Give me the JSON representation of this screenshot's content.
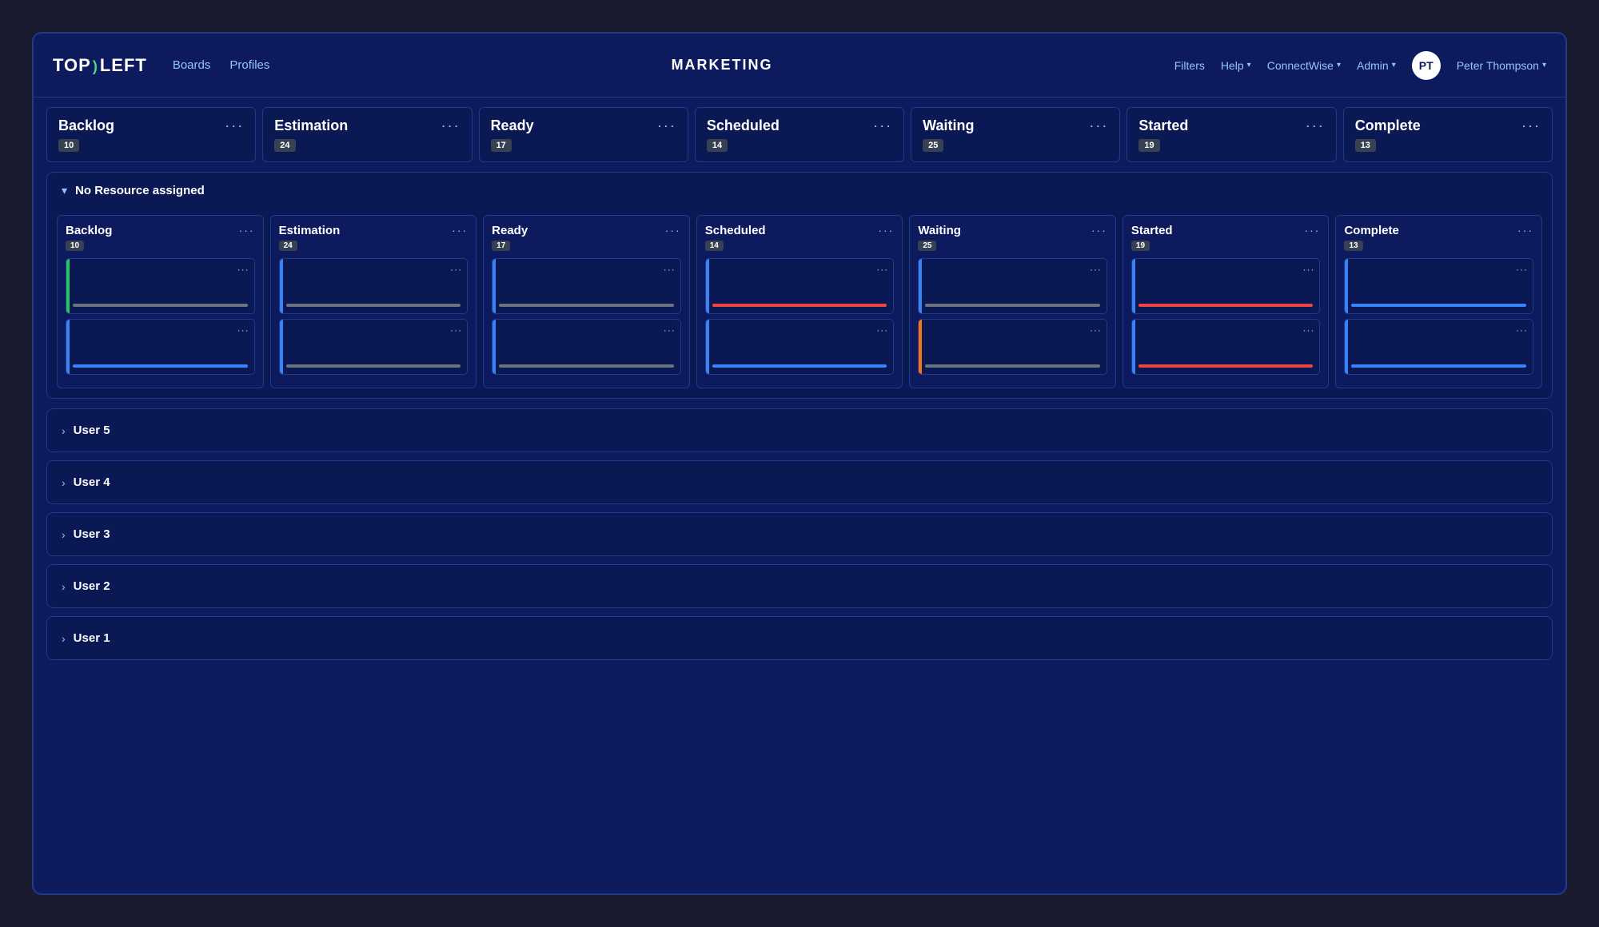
{
  "header": {
    "logo": "TOP)LEFT",
    "nav": [
      "Boards",
      "Profiles"
    ],
    "title": "MARKETING",
    "actions": [
      "Filters",
      "Help",
      "ConnectWise",
      "Admin"
    ],
    "user": {
      "name": "Peter Thompson",
      "initials": "PT"
    }
  },
  "columns": [
    {
      "id": "backlog",
      "label": "Backlog",
      "count": 10
    },
    {
      "id": "estimation",
      "label": "Estimation",
      "count": 24
    },
    {
      "id": "ready",
      "label": "Ready",
      "count": 17
    },
    {
      "id": "scheduled",
      "label": "Scheduled",
      "count": 14
    },
    {
      "id": "waiting",
      "label": "Waiting",
      "count": 25
    },
    {
      "id": "started",
      "label": "Started",
      "count": 19
    },
    {
      "id": "complete",
      "label": "Complete",
      "count": 13
    }
  ],
  "noResourceGroup": {
    "title": "No Resource assigned",
    "columns": [
      {
        "id": "backlog",
        "label": "Backlog",
        "count": 10,
        "cards": [
          {
            "accent": "green",
            "bar": "gray"
          },
          {
            "accent": "blue",
            "bar": "blue"
          }
        ]
      },
      {
        "id": "estimation",
        "label": "Estimation",
        "count": 24,
        "cards": [
          {
            "accent": "blue",
            "bar": "gray"
          },
          {
            "accent": "blue",
            "bar": "gray"
          }
        ]
      },
      {
        "id": "ready",
        "label": "Ready",
        "count": 17,
        "cards": [
          {
            "accent": "blue",
            "bar": "gray"
          },
          {
            "accent": "blue",
            "bar": "gray"
          }
        ]
      },
      {
        "id": "scheduled",
        "label": "Scheduled",
        "count": 14,
        "cards": [
          {
            "accent": "blue",
            "bar": "red"
          },
          {
            "accent": "blue",
            "bar": "blue"
          }
        ]
      },
      {
        "id": "waiting",
        "label": "Waiting",
        "count": 25,
        "cards": [
          {
            "accent": "blue",
            "bar": "gray"
          },
          {
            "accent": "orange",
            "bar": "gray"
          }
        ]
      },
      {
        "id": "started",
        "label": "Started",
        "count": 19,
        "cards": [
          {
            "accent": "blue",
            "bar": "red"
          },
          {
            "accent": "blue",
            "bar": "red"
          }
        ]
      },
      {
        "id": "complete",
        "label": "Complete",
        "count": 13,
        "cards": [
          {
            "accent": "blue",
            "bar": "blue"
          },
          {
            "accent": "blue",
            "bar": "blue"
          }
        ]
      }
    ]
  },
  "userGroups": [
    {
      "label": "User 5"
    },
    {
      "label": "User 4"
    },
    {
      "label": "User 3"
    },
    {
      "label": "User 2"
    },
    {
      "label": "User 1"
    }
  ],
  "icons": {
    "chevron_down": "▾",
    "chevron_right": "›",
    "ellipsis": "···"
  }
}
